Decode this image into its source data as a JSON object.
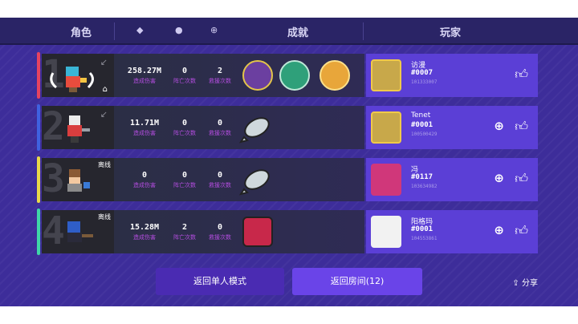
{
  "header": {
    "role": "角色",
    "achievements": "成就",
    "players": "玩家",
    "icons": [
      "sword-icon",
      "skull-icon",
      "plus-circle-icon"
    ]
  },
  "labels": {
    "damage": "造成伤害",
    "deaths": "阵亡次数",
    "rescues": "救援次数"
  },
  "rows": [
    {
      "rank": "1",
      "stripe": "#e64360",
      "tag": "",
      "damage": "258.27M",
      "deaths": "0",
      "rescues": "2",
      "name": "访漫",
      "id": "#0007",
      "num": "101333007",
      "addFriend": false
    },
    {
      "rank": "2",
      "stripe": "#3f62e0",
      "tag": "",
      "damage": "11.71M",
      "deaths": "0",
      "rescues": "0",
      "name": "Tenet",
      "id": "#0001",
      "num": "100500429",
      "addFriend": true
    },
    {
      "rank": "3",
      "stripe": "#e8d94a",
      "tag": "离线",
      "damage": "0",
      "deaths": "0",
      "rescues": "0",
      "name": "冯",
      "id": "#0117",
      "num": "103634982",
      "addFriend": true
    },
    {
      "rank": "4",
      "stripe": "#3fd6a8",
      "tag": "离线",
      "damage": "15.28M",
      "deaths": "2",
      "rescues": "0",
      "name": "阳格玛",
      "id": "#0001",
      "num": "104553861",
      "addFriend": true
    }
  ],
  "buttons": {
    "single": "返回单人模式",
    "room": "返回房间(12)",
    "share": "分享"
  }
}
